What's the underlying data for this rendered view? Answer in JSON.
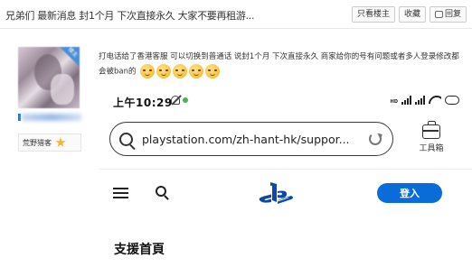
{
  "thread": {
    "title": "兄弟们 最新消息 封1个月 下次直接永久 大家不要再租游...",
    "actions": {
      "only_author": "只看楼主",
      "favorite": "收藏",
      "reply": "回复"
    }
  },
  "user": {
    "corner_badge": "楼主",
    "level": "荒野猎客"
  },
  "post": {
    "text": "打电话给了香港客服 可以切换到普通话 说封1个月 下次直接永久 商家给你的号有问题或者多人登录修改都会被ban的",
    "emojis": [
      "angry-face-icon",
      "angry-face-icon",
      "angry-face-icon",
      "angry-face-icon",
      "shocked-face-icon"
    ]
  },
  "screenshot": {
    "status_time": "上午10:29",
    "battery": "",
    "url": "playstation.com/zh-hant-hk/suppor...",
    "toolbox_label": "工具箱",
    "login_button": "登入",
    "page_heading": "支援首頁"
  }
}
